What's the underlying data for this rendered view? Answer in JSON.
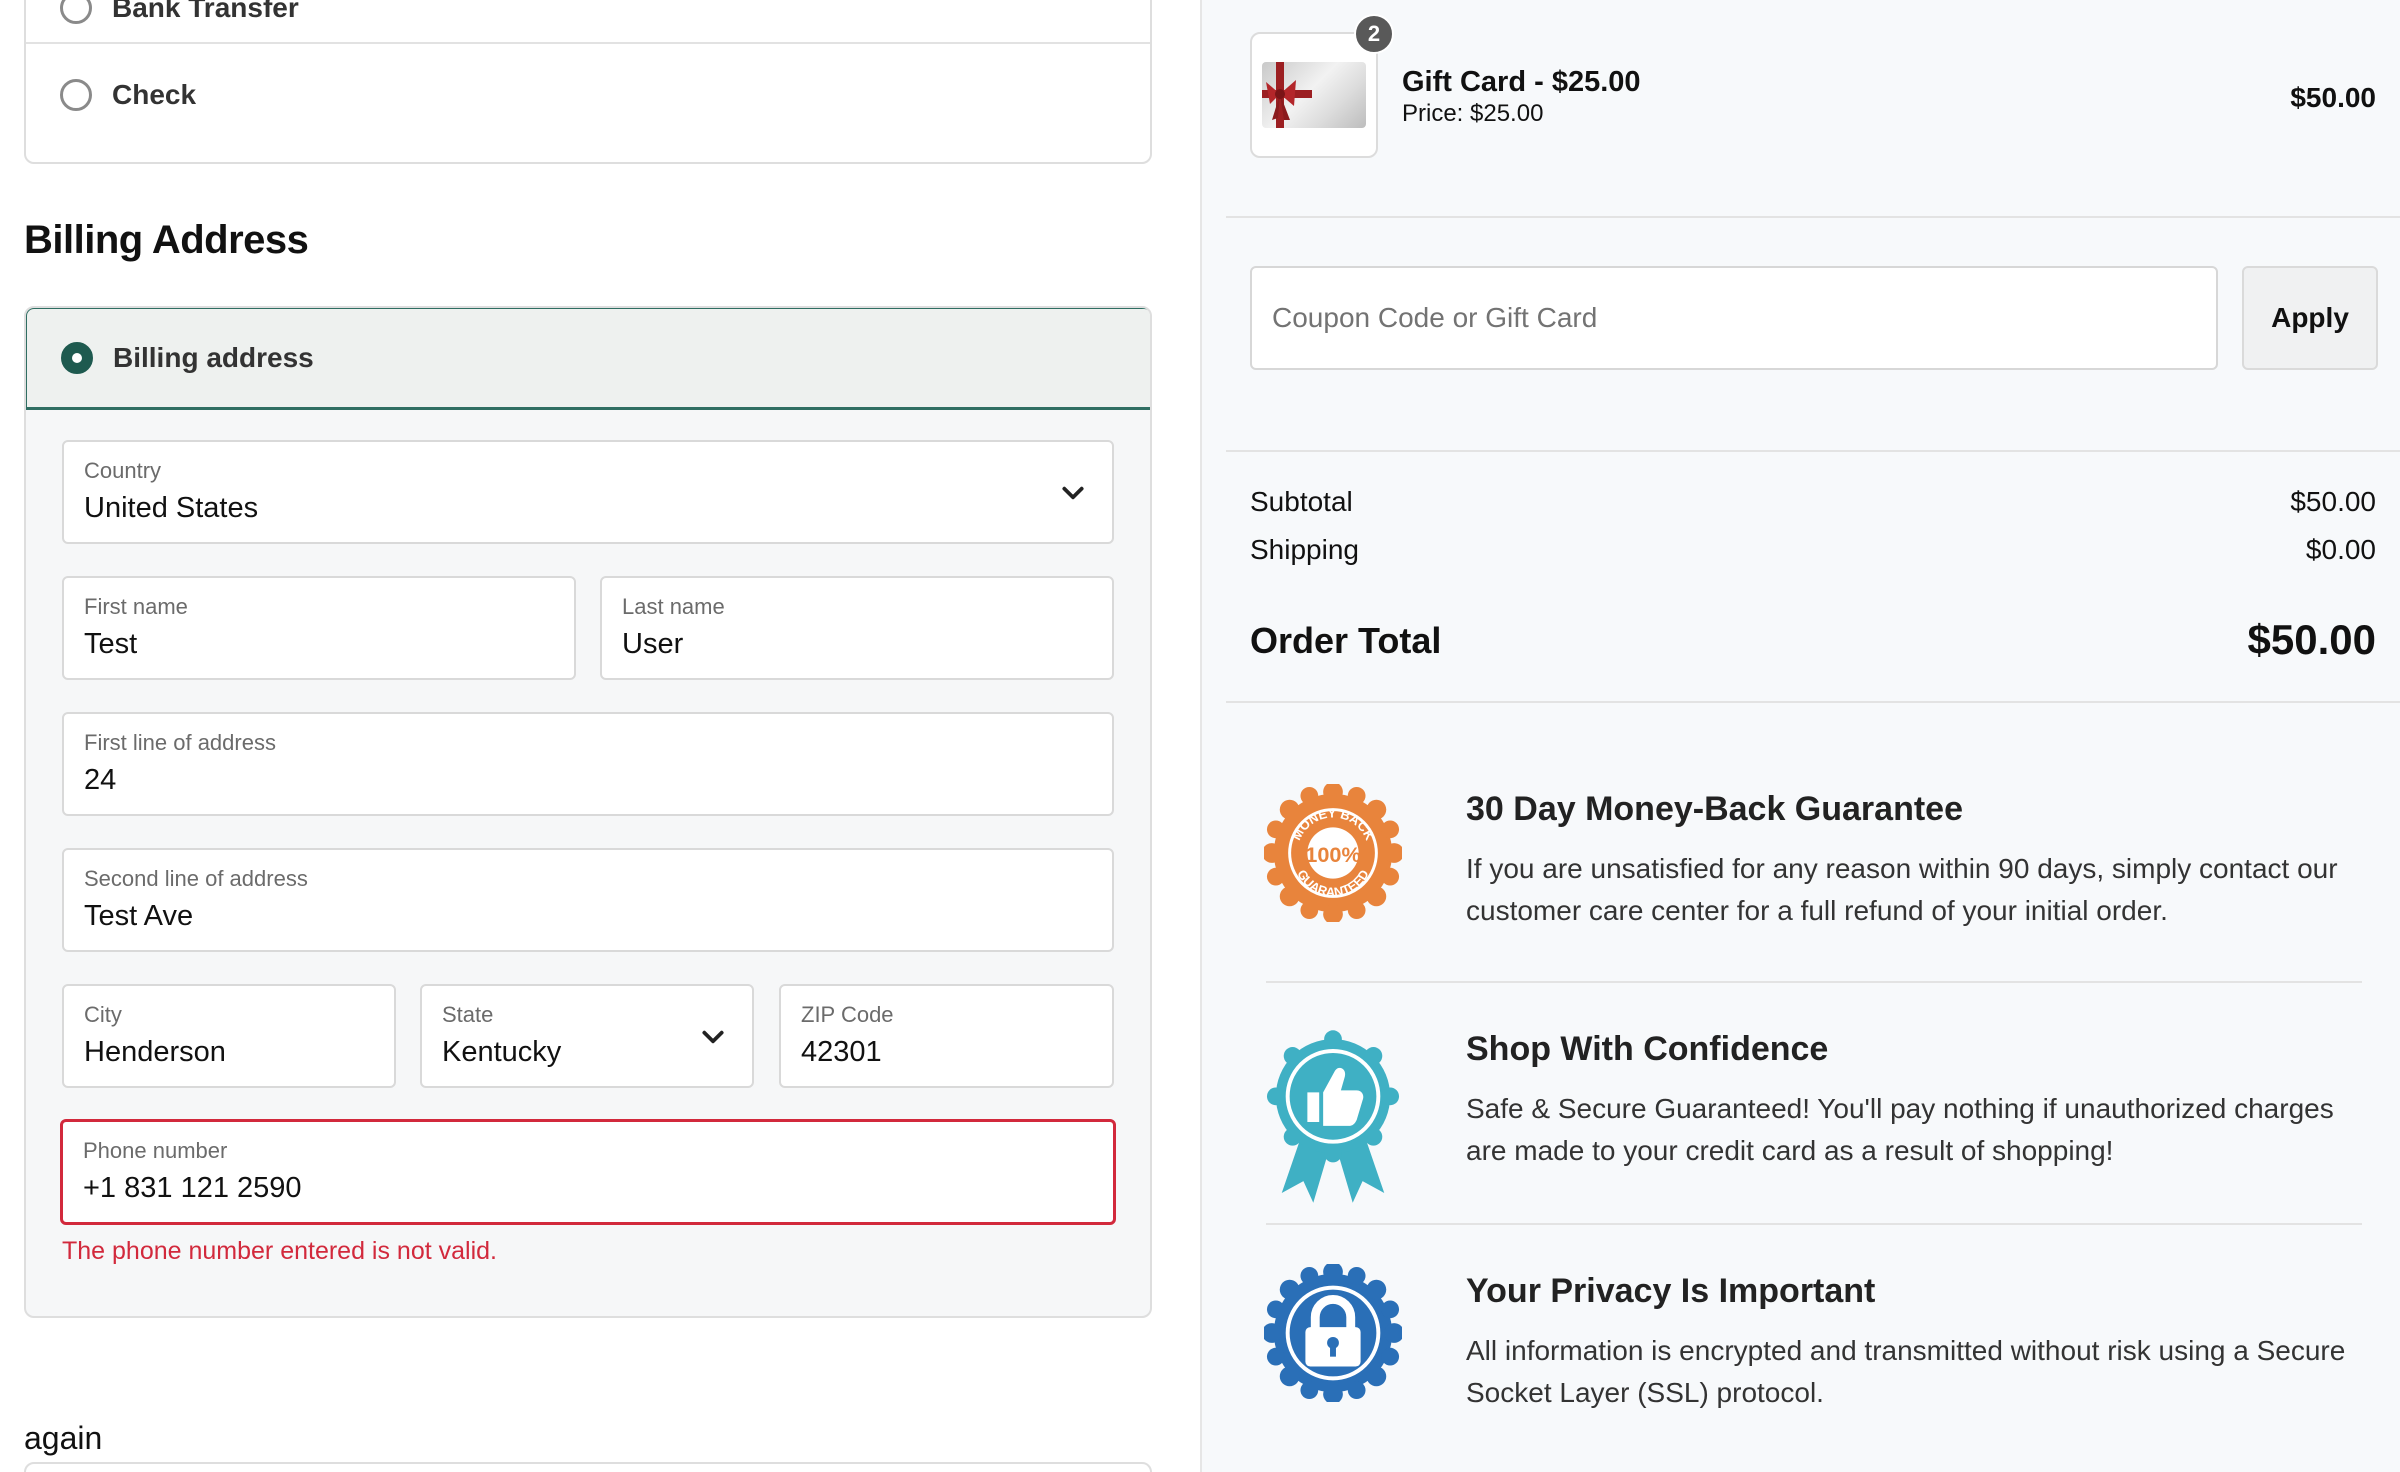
{
  "payment_methods": {
    "options": [
      {
        "label": "Bank Transfer"
      },
      {
        "label": "Check"
      }
    ]
  },
  "billing": {
    "heading": "Billing Address",
    "option_label": "Billing address",
    "fields": {
      "country": {
        "label": "Country",
        "value": "United States"
      },
      "first_name": {
        "label": "First name",
        "value": "Test"
      },
      "last_name": {
        "label": "Last name",
        "value": "User"
      },
      "address1": {
        "label": "First line of address",
        "value": "24"
      },
      "address2": {
        "label": "Second line of address",
        "value": "Test Ave"
      },
      "city": {
        "label": "City",
        "value": "Henderson"
      },
      "state": {
        "label": "State",
        "value": "Kentucky"
      },
      "zip": {
        "label": "ZIP Code",
        "value": "42301"
      },
      "phone": {
        "label": "Phone number",
        "value": "+1 831 121 2590"
      }
    },
    "phone_error": "The phone number entered is not valid."
  },
  "again_text": "again",
  "order": {
    "item": {
      "name": "Gift Card - $25.00",
      "price": "Price: $25.00",
      "quantity": "2",
      "total": "$50.00"
    },
    "coupon": {
      "placeholder": "Coupon Code or Gift Card",
      "apply_label": "Apply"
    },
    "subtotal_label": "Subtotal",
    "subtotal_value": "$50.00",
    "shipping_label": "Shipping",
    "shipping_value": "$0.00",
    "total_label": "Order Total",
    "total_value": "$50.00"
  },
  "guarantees": [
    {
      "title": "30 Day Money-Back Guarantee",
      "text": "If you are unsatisfied for any reason within 90 days, simply contact our customer care center for a full refund of your initial order.",
      "icon": "money-back-seal-icon",
      "badge_top": "MONEY BACK",
      "badge_center": "100%",
      "badge_bottom": "GUARANTEED"
    },
    {
      "title": "Shop With Confidence",
      "text": "Safe & Secure Guaranteed! You'll pay nothing if unauthorized charges are made to your credit card as a result of shopping!",
      "icon": "thumbs-up-ribbon-icon"
    },
    {
      "title": "Your Privacy Is Important",
      "text": "All information is encrypted and transmitted without risk using a Secure Socket Layer (SSL) protocol.",
      "icon": "padlock-seal-icon"
    }
  ],
  "colors": {
    "accent": "#1e5a4f",
    "error": "#d2293c",
    "seal_orange": "#e8843c",
    "seal_teal": "#3fb0c4",
    "seal_blue": "#2a6fb7"
  }
}
